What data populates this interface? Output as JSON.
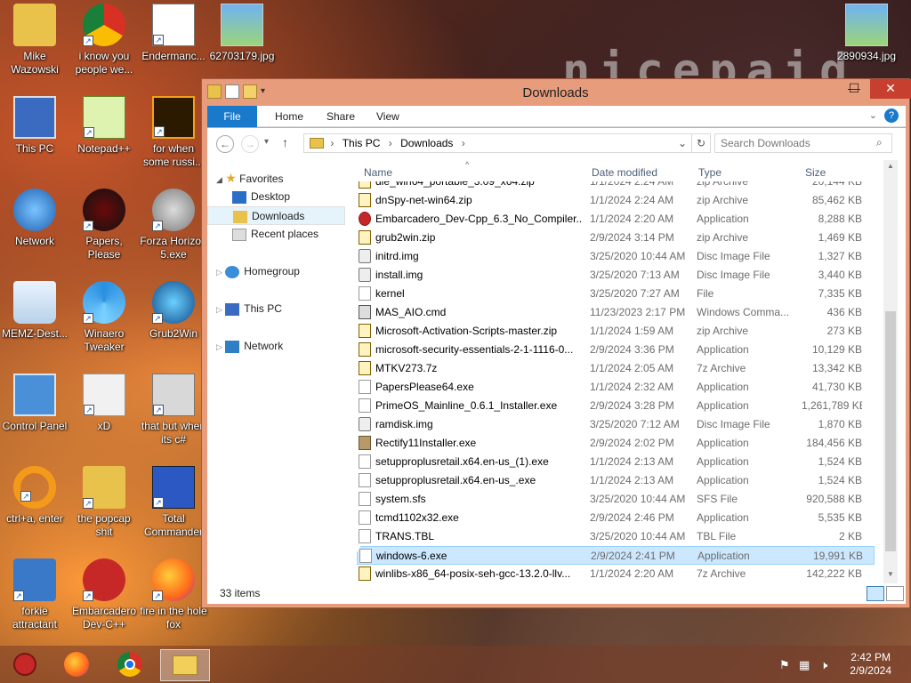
{
  "wallpaper": {
    "text": "nicepaid"
  },
  "desktop_icons": [
    {
      "label": "Mike Wazowski",
      "icon": "folder-user-icon"
    },
    {
      "label": "i know you people we...",
      "icon": "chrome-icon"
    },
    {
      "label": "Endermanc...",
      "icon": "document-shortcut-icon"
    },
    {
      "label": "62703179.jpg",
      "icon": "image-icon"
    },
    {
      "label": "2890934.jpg",
      "icon": "image-icon"
    },
    {
      "label": "This PC",
      "icon": "computer-icon"
    },
    {
      "label": "Notepad++",
      "icon": "notepad-icon"
    },
    {
      "label": "for when some russi...",
      "icon": "adobe-icon"
    },
    {
      "label": "Network",
      "icon": "network-icon"
    },
    {
      "label": "Papers, Please",
      "icon": "papers-icon"
    },
    {
      "label": "Forza Horizon 5.exe",
      "icon": "flash-icon"
    },
    {
      "label": "MEMZ-Dest...",
      "icon": "recycle-bin-icon"
    },
    {
      "label": "Winaero Tweaker",
      "icon": "winaero-icon"
    },
    {
      "label": "Grub2Win",
      "icon": "grub-icon"
    },
    {
      "label": "Control Panel",
      "icon": "control-panel-icon"
    },
    {
      "label": "xD",
      "icon": "hxd-icon"
    },
    {
      "label": "that but when its c#",
      "icon": "copy-icon"
    },
    {
      "label": "ctrl+a, enter",
      "icon": "ring-icon"
    },
    {
      "label": "the popcap shit",
      "icon": "folder-icon"
    },
    {
      "label": "Total Commander",
      "icon": "floppy-icon"
    },
    {
      "label": "forkie attractant",
      "icon": "gear-monitor-icon"
    },
    {
      "label": "Embarcadero Dev-C++",
      "icon": "devcpp-icon"
    },
    {
      "label": "fire in the hole fox",
      "icon": "firefox-icon"
    }
  ],
  "window": {
    "title": "Downloads",
    "minimize": "—",
    "maximize": "☐",
    "close": "✕",
    "tabs": [
      "File",
      "Home",
      "Share",
      "View"
    ],
    "breadcrumb": [
      "This PC",
      "Downloads"
    ],
    "search_placeholder": "Search Downloads",
    "nav": {
      "favorites": "Favorites",
      "desktop": "Desktop",
      "downloads": "Downloads",
      "recent": "Recent places",
      "homegroup": "Homegroup",
      "this_pc": "This PC",
      "network": "Network"
    },
    "columns": {
      "name": "Name",
      "date": "Date modified",
      "type": "Type",
      "size": "Size"
    },
    "files": [
      {
        "name": "die_win64_portable_3.09_x64.zip",
        "date": "1/1/2024 2:24 AM",
        "type": "zip Archive",
        "size": "20,144 KB",
        "icon": "zip"
      },
      {
        "name": "dnSpy-net-win64.zip",
        "date": "1/1/2024 2:24 AM",
        "type": "zip Archive",
        "size": "85,462 KB",
        "icon": "zip"
      },
      {
        "name": "Embarcadero_Dev-Cpp_6.3_No_Compiler...",
        "date": "1/1/2024 2:20 AM",
        "type": "Application",
        "size": "8,288 KB",
        "icon": "dev"
      },
      {
        "name": "grub2win.zip",
        "date": "2/9/2024 3:14 PM",
        "type": "zip Archive",
        "size": "1,469 KB",
        "icon": "zip"
      },
      {
        "name": "initrd.img",
        "date": "3/25/2020 10:44 AM",
        "type": "Disc Image File",
        "size": "1,327 KB",
        "icon": "img"
      },
      {
        "name": "install.img",
        "date": "3/25/2020 7:13 AM",
        "type": "Disc Image File",
        "size": "3,440 KB",
        "icon": "img"
      },
      {
        "name": "kernel",
        "date": "3/25/2020 7:27 AM",
        "type": "File",
        "size": "7,335 KB",
        "icon": "app"
      },
      {
        "name": "MAS_AIO.cmd",
        "date": "11/23/2023 2:17 PM",
        "type": "Windows Comma...",
        "size": "436 KB",
        "icon": "cmd"
      },
      {
        "name": "Microsoft-Activation-Scripts-master.zip",
        "date": "1/1/2024 1:59 AM",
        "type": "zip Archive",
        "size": "273 KB",
        "icon": "zip"
      },
      {
        "name": "microsoft-security-essentials-2-1-1116-0...",
        "date": "2/9/2024 3:36 PM",
        "type": "Application",
        "size": "10,129 KB",
        "icon": "zip"
      },
      {
        "name": "MTKV273.7z",
        "date": "1/1/2024 2:05 AM",
        "type": "7z Archive",
        "size": "13,342 KB",
        "icon": "zip"
      },
      {
        "name": "PapersPlease64.exe",
        "date": "1/1/2024 2:32 AM",
        "type": "Application",
        "size": "41,730 KB",
        "icon": "app"
      },
      {
        "name": "PrimeOS_Mainline_0.6.1_Installer.exe",
        "date": "2/9/2024 3:28 PM",
        "type": "Application",
        "size": "1,261,789 KB",
        "icon": "app"
      },
      {
        "name": "ramdisk.img",
        "date": "3/25/2020 7:12 AM",
        "type": "Disc Image File",
        "size": "1,870 KB",
        "icon": "img"
      },
      {
        "name": "Rectify11Installer.exe",
        "date": "2/9/2024 2:02 PM",
        "type": "Application",
        "size": "184,456 KB",
        "icon": "rect"
      },
      {
        "name": "setupproplusretail.x64.en-us_(1).exe",
        "date": "1/1/2024 2:13 AM",
        "type": "Application",
        "size": "1,524 KB",
        "icon": "app"
      },
      {
        "name": "setupproplusretail.x64.en-us_.exe",
        "date": "1/1/2024 2:13 AM",
        "type": "Application",
        "size": "1,524 KB",
        "icon": "app"
      },
      {
        "name": "system.sfs",
        "date": "3/25/2020 10:44 AM",
        "type": "SFS File",
        "size": "920,588 KB",
        "icon": "app"
      },
      {
        "name": "tcmd1102x32.exe",
        "date": "2/9/2024 2:46 PM",
        "type": "Application",
        "size": "5,535 KB",
        "icon": "app"
      },
      {
        "name": "TRANS.TBL",
        "date": "3/25/2020 10:44 AM",
        "type": "TBL File",
        "size": "2 KB",
        "icon": "app"
      },
      {
        "name": "windows-6.exe",
        "date": "2/9/2024 2:41 PM",
        "type": "Application",
        "size": "19,991 KB",
        "icon": "app",
        "selected": true
      },
      {
        "name": "winlibs-x86_64-posix-seh-gcc-13.2.0-llv...",
        "date": "1/1/2024 2:20 AM",
        "type": "7z Archive",
        "size": "142,222 KB",
        "icon": "zip"
      }
    ],
    "status": "33 items"
  },
  "taskbar": {
    "apps": [
      "malware-icon",
      "firefox-icon",
      "chrome-icon",
      "file-explorer-icon"
    ],
    "time": "2:42 PM",
    "date": "2/9/2024"
  }
}
